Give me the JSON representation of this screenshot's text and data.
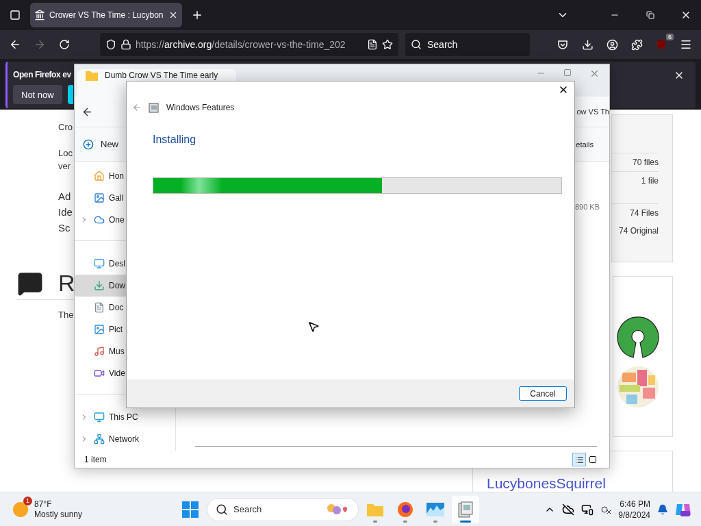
{
  "browser": {
    "tab": {
      "title": "Crower VS The Time : Lucybon",
      "selected": true
    },
    "url": {
      "scheme": "https://",
      "domain": "archive.org",
      "path": "/details/crower-vs-the-time_202"
    },
    "search": {
      "placeholder": "Search"
    },
    "extension_badge": "6"
  },
  "notification": {
    "message": "Open Firefox ev",
    "button": "Not now"
  },
  "page": {
    "paragraphs": [
      [
        "Cro"
      ],
      [
        "Loc",
        "ver"
      ]
    ],
    "large_paragraph": [
      "Ad",
      "Ide",
      "Sc"
    ],
    "heading": "R",
    "body": "The",
    "file_counts": [
      "70 files",
      "1 file"
    ],
    "totals": [
      "74 Files",
      "74 Original"
    ],
    "uploader": "LucybonesSquirrel"
  },
  "explorer": {
    "tab_title": "Dumb Crow VS The Time early",
    "address": "ow VS Th",
    "new_button": "New",
    "details_button": "etails",
    "size": "890 KB",
    "nav": [
      [
        {
          "label": "Hon",
          "kind": "home",
          "expandable": false,
          "selected": false
        },
        {
          "label": "Gall",
          "kind": "gallery",
          "expandable": false,
          "selected": false
        },
        {
          "label": "One",
          "kind": "cloud",
          "expandable": true,
          "selected": false
        }
      ],
      [
        {
          "label": "Desl",
          "kind": "desktop",
          "expandable": false,
          "selected": false
        },
        {
          "label": "Dow",
          "kind": "downloads",
          "expandable": false,
          "selected": true
        },
        {
          "label": "Doc",
          "kind": "documents",
          "expandable": false,
          "selected": false
        },
        {
          "label": "Pict",
          "kind": "pictures",
          "expandable": false,
          "selected": false
        },
        {
          "label": "Mus",
          "kind": "music",
          "expandable": false,
          "selected": false
        },
        {
          "label": "Vide",
          "kind": "videos",
          "expandable": false,
          "selected": false
        }
      ],
      [
        {
          "label": "This PC",
          "kind": "pc",
          "expandable": true,
          "selected": false
        },
        {
          "label": "Network",
          "kind": "network",
          "expandable": true,
          "selected": false
        }
      ]
    ],
    "status": "1 item",
    "views": [
      {
        "kind": "details",
        "selected": true
      },
      {
        "kind": "tiles",
        "selected": false
      }
    ]
  },
  "dialog": {
    "title": "Windows Features",
    "heading": "Installing",
    "level": 0.56,
    "button": "Cancel"
  },
  "taskbar": {
    "weather": {
      "temperature": "87°F",
      "condition": "Mostly sunny",
      "badge": "1"
    },
    "search": {
      "placeholder": "Search"
    },
    "apps": [
      {
        "kind": "explorer",
        "selected": false
      },
      {
        "kind": "firefox",
        "selected": false
      },
      {
        "kind": "photos",
        "selected": false
      },
      {
        "kind": "features",
        "selected": true
      }
    ],
    "time": "6:46 PM",
    "date": "9/8/2024"
  }
}
